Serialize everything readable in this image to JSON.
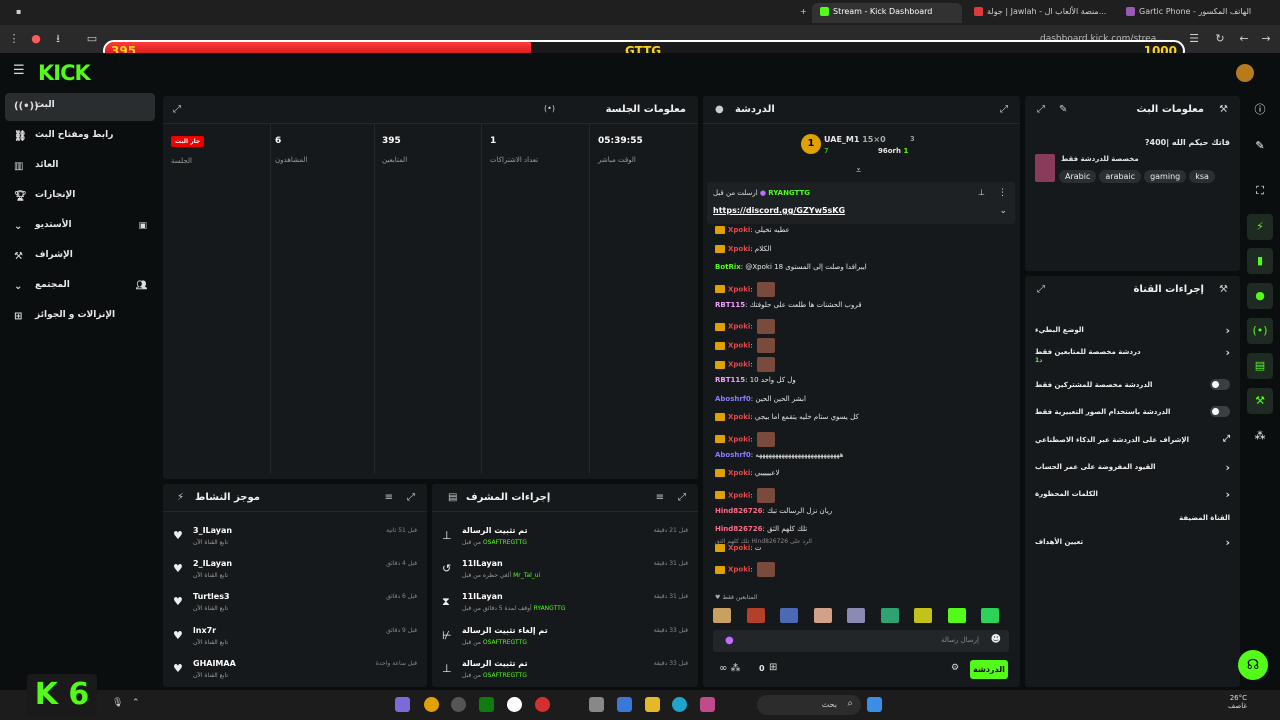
{
  "browser": {
    "tabs": [
      {
        "label": "Stream - Kick Dashboard",
        "color": "#53fc18"
      },
      {
        "label": "جولة | Jawlah - منصة الألعاب ال...",
        "color": "#e03a3a"
      },
      {
        "label": "Gartic Phone - الهاتف المكسور",
        "color": "#9b59b6"
      }
    ],
    "url": "dashboard.kick.com/strea..."
  },
  "overlay": {
    "left_value": "395",
    "center_label": "GTTG",
    "right_value": "1000",
    "fill_fraction": 0.395
  },
  "header": {
    "logo": "KICK"
  },
  "sidebar": {
    "items": [
      {
        "label": "البث",
        "icon": "broadcast-icon"
      },
      {
        "label": "رابط ومفتاح البث",
        "icon": "link-icon"
      },
      {
        "label": "العائد",
        "icon": "chart-icon"
      },
      {
        "label": "الإنجازات",
        "icon": "trophy-icon"
      },
      {
        "label": "الأستديو",
        "icon": "chevron-down-icon"
      },
      {
        "label": "الإشراف",
        "icon": "hammer-icon"
      },
      {
        "label": "المجتمع",
        "icon": "chevron-down-icon"
      },
      {
        "label": "الإنزالات و الجوائز",
        "icon": "gift-icon"
      }
    ]
  },
  "session": {
    "title": "معلومات الجلسة",
    "stats": [
      {
        "value": "05:39:55",
        "label": "الوقت مباشر"
      },
      {
        "value": "1",
        "label": "تعداد الاشتراكات"
      },
      {
        "value": "395",
        "label": "المتابعين"
      },
      {
        "value": "6",
        "label": "المشاهدون"
      },
      {
        "value": "جار البث",
        "label": "الجلسة"
      }
    ]
  },
  "activity": {
    "title": "موجز النشاط",
    "items": [
      {
        "name": "3_ILayan",
        "sub": "تابع القناة الآن",
        "time": "قبل 51 ثانية"
      },
      {
        "name": "2_ILayan",
        "sub": "تابع القناة الآن",
        "time": "قبل 4 دقائق"
      },
      {
        "name": "Turtles3",
        "sub": "تابع القناة الآن",
        "time": "قبل 6 دقائق"
      },
      {
        "name": "lnx7r",
        "sub": "تابع القناة الآن",
        "time": "قبل 9 دقائق"
      },
      {
        "name": "GHAIMAA",
        "sub": "تابع القناة الآن",
        "time": "قبل ساعة واحدة"
      }
    ]
  },
  "modactions": {
    "title": "إجراءات المشرف",
    "items": [
      {
        "name": "تم تثبيت الرسالة",
        "prefix": "من قبل",
        "actor": "OSAFTREGTTG",
        "time": "قبل 21 دقيقة",
        "icon": "pin-icon"
      },
      {
        "name": "11ILayan",
        "prefix": "ألغي حظره من قبل",
        "actor": "Mr_Tal_ui",
        "time": "قبل 31 دقيقة",
        "icon": "undo-icon"
      },
      {
        "name": "11ILayan",
        "prefix": "أوقف لمدة 5 دقائق من قبل",
        "actor": "RYANGTTG",
        "time": "قبل 31 دقيقة",
        "icon": "hourglass-icon"
      },
      {
        "name": "تم إلغاء تثبيت الرسالة",
        "prefix": "من قبل",
        "actor": "OSAFTREGTTG",
        "time": "قبل 33 دقيقة",
        "icon": "unpin-icon"
      },
      {
        "name": "تم تثبيت الرسالة",
        "prefix": "من قبل",
        "actor": "OSAFTREGTTG",
        "time": "قبل 33 دقيقة",
        "icon": "pin-icon"
      }
    ]
  },
  "chat": {
    "title": "الدردشة",
    "top_users": [
      {
        "name": "UAE_M1",
        "a": "15×0",
        "b": "7"
      },
      {
        "name": "96orh",
        "a": "3",
        "b": "1"
      }
    ],
    "pinned": {
      "by": "ارسلت من قبل",
      "user": "RYANGTTG",
      "link": "https://discord.gg/GZYw5sKG"
    },
    "messages": [
      {
        "user": "Xpoki",
        "text": "عطيه تخيلي",
        "color": "#e04a4a",
        "crown": true
      },
      {
        "user": "Xpoki",
        "text": "الكلام",
        "color": "#e04a4a",
        "crown": true
      },
      {
        "user": "BotRix",
        "text": "@Xpoki 18 ايبرافدا وصلت إلى المستوى",
        "color": "#53fc18",
        "crown": false
      },
      {
        "user": "Xpoki",
        "text": "",
        "color": "#e04a4a",
        "crown": true,
        "emote": true
      },
      {
        "user": "RBT115",
        "text": "قروب الحشنات ها طلعت على حلوفتك",
        "color": "#f0a0ff",
        "crown": false
      },
      {
        "user": "Xpoki",
        "text": "",
        "color": "#e04a4a",
        "crown": true,
        "emote": true
      },
      {
        "user": "Xpoki",
        "text": "",
        "color": "#e04a4a",
        "crown": true,
        "emote": true
      },
      {
        "user": "Xpoki",
        "text": "",
        "color": "#e04a4a",
        "crown": true,
        "emote": true
      },
      {
        "user": "RBT115",
        "text": "ول كل واحد 10",
        "color": "#f0a0ff",
        "crown": false
      },
      {
        "user": "Aboshrf0",
        "text": "ابشر الحين الحين",
        "color": "#8a7dff",
        "crown": false
      },
      {
        "user": "Xpoki",
        "text": "كل يسوي ستام خليه يتقمع اما بيجي",
        "color": "#e04a4a",
        "crown": true
      },
      {
        "user": "Xpoki",
        "text": "",
        "color": "#e04a4a",
        "crown": true,
        "emote": true
      },
      {
        "user": "Aboshrf0",
        "text": "ههههههههههههههههههههههههههه",
        "color": "#8a7dff",
        "crown": false
      },
      {
        "user": "Xpoki",
        "text": "لاعيييييي",
        "color": "#e04a4a",
        "crown": true
      },
      {
        "user": "Xpoki",
        "text": "",
        "color": "#e04a4a",
        "crown": true,
        "emote": true
      },
      {
        "user": "Hind826726",
        "text": "ريان نزل الرسالت تبك",
        "color": "#ff6b8a",
        "crown": false
      },
      {
        "user": "Hind826726",
        "text": "تلك كلهم الثق",
        "color": "#ff6b8a",
        "crown": false
      },
      {
        "user": "Xpoki",
        "text": "ت",
        "color": "#e04a4a",
        "crown": true
      },
      {
        "user": "Xpoki",
        "text": "",
        "color": "#e04a4a",
        "crown": true,
        "emote": true
      }
    ],
    "reply_hint": "تلك كلهم الثق Hind826726 الرد على",
    "input_placeholder": "إرسال رسالة",
    "send_label": "الدردشة",
    "viewers": "0",
    "subs_label": "المتابعين فقط"
  },
  "streaminfo": {
    "title": "معلومات البث",
    "stream_title": "?قاتك حيكم الله |400",
    "category": "مخصصة للدردشة فقط",
    "tags": [
      "Arabic",
      "arabaic",
      "gaming",
      "ksa"
    ]
  },
  "channelactions": {
    "title": "إجراءات القناة",
    "items": [
      {
        "label": "الوضع البطيء",
        "kind": "chevron"
      },
      {
        "label": "دردشة مخصصة للمتابعين فقط",
        "sub": "1د",
        "kind": "chevron"
      },
      {
        "label": "الدردشة مخصصة للمشتركين فقط",
        "kind": "toggle"
      },
      {
        "label": "الدردشة باستخدام الصور التعبيرية فقط",
        "kind": "toggle"
      },
      {
        "label": "الإشراف على الدردشة عبر الذكاء الاصطناعي",
        "kind": "external"
      },
      {
        "label": "القيود المفروضة على عمر الحساب",
        "kind": "chevron"
      },
      {
        "label": "الكلمات المحظورة",
        "kind": "chevron"
      },
      {
        "label": "القناة المضيفة",
        "kind": "none"
      },
      {
        "label": "تعيين الأهداف",
        "kind": "chevron"
      }
    ]
  },
  "taskbar": {
    "search": "بحث",
    "temp": "26°C",
    "weather": "غاصف",
    "badge": "K 6"
  }
}
